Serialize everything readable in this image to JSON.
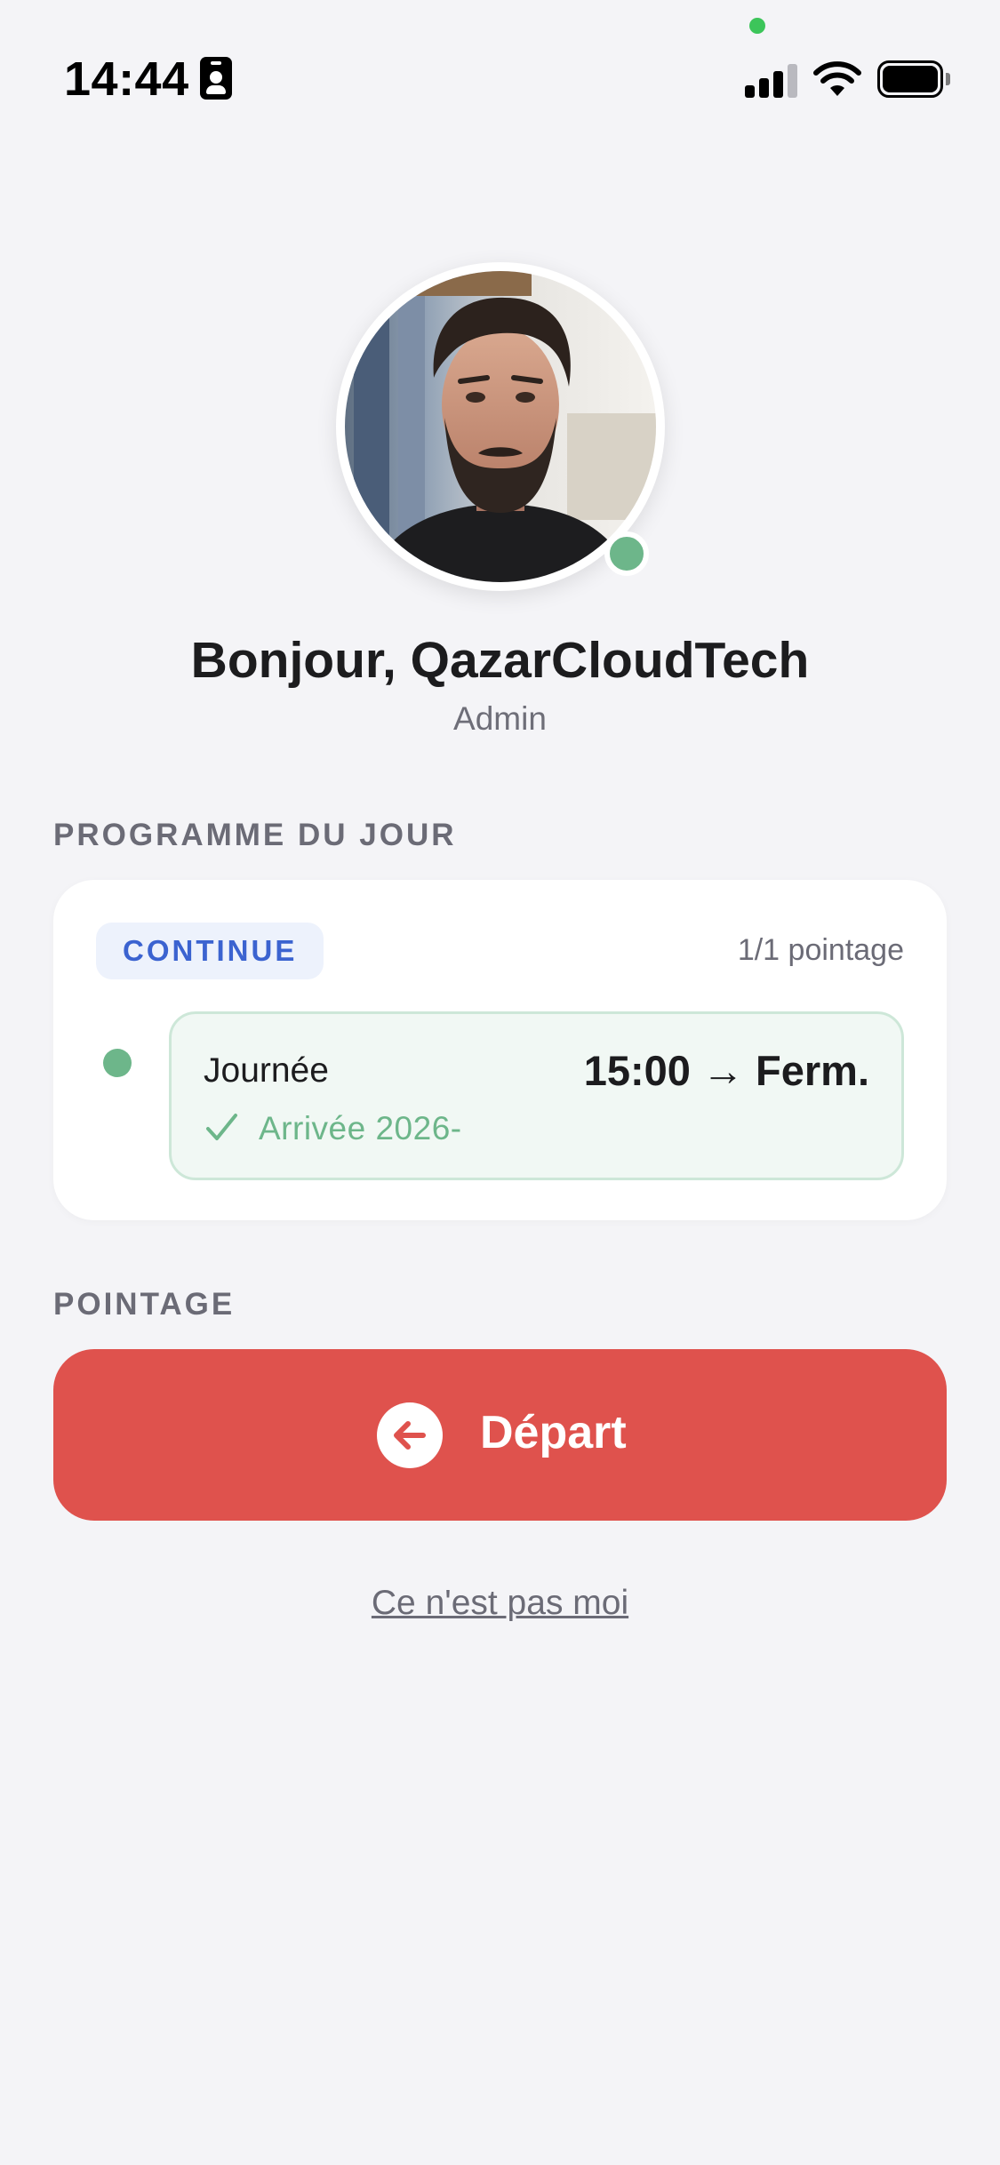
{
  "status_bar": {
    "time": "14:44",
    "icons": [
      "contact-card-icon",
      "cellular-signal-icon",
      "wifi-icon",
      "battery-icon"
    ],
    "privacy_indicator_color": "#3cc55a"
  },
  "profile": {
    "greeting": "Bonjour, QazarCloudTech",
    "role": "Admin",
    "online": true,
    "online_color": "#6db68a"
  },
  "schedule": {
    "section_title": "PROGRAMME DU JOUR",
    "badge": "CONTINUE",
    "count": "1/1 pointage",
    "shift": {
      "name": "Journée",
      "hours": "15:00 → Ferm.",
      "arrival": "Arrivée 2026-"
    }
  },
  "pointage": {
    "section_title": "POINTAGE",
    "button_label": "Départ",
    "button_color": "#df524d"
  },
  "footer": {
    "not_me_link": "Ce n'est pas moi"
  },
  "colors": {
    "background": "#f4f4f7",
    "accent_blue": "#3b63d0",
    "success_green": "#6db68a"
  }
}
